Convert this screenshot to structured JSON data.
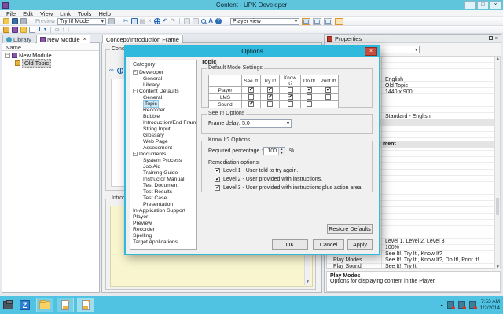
{
  "window": {
    "title": "Content - UPK Developer"
  },
  "menu": {
    "items": [
      "File",
      "Edit",
      "View",
      "Link",
      "Tools",
      "Help"
    ]
  },
  "toolbar": {
    "preview_label": "Preview",
    "mode_value": "Try It! Mode",
    "view_value": "Player view"
  },
  "left_panel": {
    "tabs": [
      {
        "label": "Library"
      },
      {
        "label": "New Module"
      }
    ],
    "column_header": "Name",
    "tree": [
      {
        "label": "New Module",
        "selected": false
      },
      {
        "label": "Old Topic",
        "selected": true
      }
    ]
  },
  "middle_panel": {
    "tab_label": "Concept/Introduction Frame",
    "concept_label": "Concept",
    "introduction_label": "Introduction"
  },
  "properties": {
    "title": "Properties",
    "top_values": [
      "English",
      "Old Topic",
      "1440 x 900",
      "Standard - English"
    ],
    "section_header_fragment": "ment",
    "bottom_rows": [
      {
        "name": "",
        "value": "Level 1, Level 2, Level 3"
      },
      {
        "name": "",
        "value": "100%"
      },
      {
        "name": "",
        "value": "See It!, Try It!, Know It?"
      },
      {
        "name": "Play Modes",
        "value": "See It!, Try It!, Know It?, Do It!, Print It!"
      },
      {
        "name": "Play Sound",
        "value": "See It!, Try It!"
      }
    ],
    "description": {
      "title": "Play Modes",
      "text": "Options for displaying content in the Player."
    }
  },
  "dialog": {
    "title": "Options",
    "category_header": "Category",
    "tree": [
      {
        "label": "Developer",
        "depth": 0,
        "parent": true
      },
      {
        "label": "General",
        "depth": 1
      },
      {
        "label": "Library",
        "depth": 1
      },
      {
        "label": "Content Defaults",
        "depth": 0,
        "parent": true
      },
      {
        "label": "General",
        "depth": 1
      },
      {
        "label": "Topic",
        "depth": 1,
        "selected": true
      },
      {
        "label": "Recorder",
        "depth": 1
      },
      {
        "label": "Bubble",
        "depth": 1
      },
      {
        "label": "Introduction/End Frame",
        "depth": 1
      },
      {
        "label": "String Input",
        "depth": 1
      },
      {
        "label": "Glossary",
        "depth": 1
      },
      {
        "label": "Web Page",
        "depth": 1
      },
      {
        "label": "Assessment",
        "depth": 1
      },
      {
        "label": "Documents",
        "depth": 0,
        "parent": true
      },
      {
        "label": "System Process",
        "depth": 1
      },
      {
        "label": "Job Aid",
        "depth": 1
      },
      {
        "label": "Training Guide",
        "depth": 1
      },
      {
        "label": "Instructor Manual",
        "depth": 1
      },
      {
        "label": "Test Document",
        "depth": 1
      },
      {
        "label": "Test Results",
        "depth": 1
      },
      {
        "label": "Test Case",
        "depth": 1
      },
      {
        "label": "Presentation",
        "depth": 1
      },
      {
        "label": "In-Application Support",
        "depth": 0
      },
      {
        "label": "Player",
        "depth": 0
      },
      {
        "label": "Preview",
        "depth": 0
      },
      {
        "label": "Recorder",
        "depth": 0
      },
      {
        "label": "Spelling",
        "depth": 0
      },
      {
        "label": "Target Applications",
        "depth": 0
      }
    ],
    "topic": {
      "header": "Topic",
      "default_modes": {
        "label": "Default Mode Settings",
        "columns": [
          "See It!",
          "Try It!",
          "Know It?",
          "Do It!",
          "Print It!"
        ],
        "rows": [
          {
            "name": "Player",
            "checks": [
              true,
              true,
              false,
              true,
              true
            ]
          },
          {
            "name": "LMS",
            "checks": [
              false,
              true,
              true,
              false,
              false
            ]
          },
          {
            "name": "Sound",
            "checks": [
              true,
              false,
              false,
              false,
              null
            ]
          }
        ]
      },
      "see_it": {
        "label": "See It! Options",
        "frame_delay_label": "Frame delay:",
        "frame_delay_value": "5.0"
      },
      "know_it": {
        "label": "Know It? Options",
        "required_label": "Required percentage :",
        "required_value": "100",
        "percent": "%",
        "remediation_label": "Remediation options:",
        "levels": [
          {
            "checked": true,
            "label": "Level 1 - User told to try again."
          },
          {
            "checked": true,
            "label": "Level 2 - User provided with instructions."
          },
          {
            "checked": true,
            "label": "Level 3 - User provided with instructions plus action area."
          }
        ]
      },
      "restore_button": "Restore Defaults",
      "ok_button": "OK",
      "cancel_button": "Cancel",
      "apply_button": "Apply"
    }
  },
  "taskbar": {
    "time": "7:53 AM",
    "date": "1/2/2014"
  },
  "icons": {
    "minimize": "–",
    "maximize": "□",
    "close": "×",
    "cut": "✂",
    "paste": "▤",
    "delete": "×",
    "undo": "↶",
    "redo": "↷",
    "help": "?",
    "link": "∞",
    "up": "↑",
    "down": "↓",
    "dropdown": "▾",
    "collapse": "−",
    "scroll_up": "▲",
    "scroll_down": "▼",
    "tray_expand": "▴",
    "filter": "T"
  }
}
